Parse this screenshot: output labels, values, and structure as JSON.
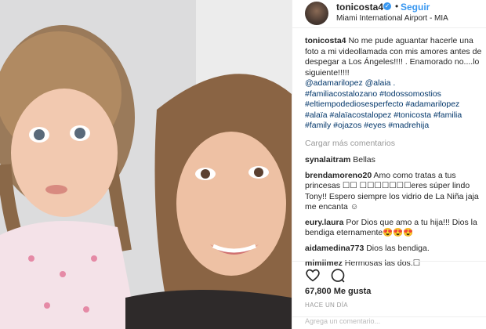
{
  "post": {
    "username": "tonicosta4",
    "separator": "•",
    "follow_label": "Seguir",
    "location": "Miami International Airport - MIA"
  },
  "caption": {
    "username": "tonicosta4",
    "text": "No me pude aguantar hacerle una foto a mi videollamada con mis amores antes de despegar a Los Ángeles!!!! . Enamorado no....lo siguiente!!!!!",
    "mentions": "@adamarilopez @alaia .",
    "hashtags_line1": "#familiacostalozano #todossomostios",
    "hashtags_line2": "#eltiempodediosesperfecto #adamarilopez",
    "hashtags_line3": "#alaïa #alaïacostalopez #tonicosta #familia",
    "hashtags_line4": "#family #ojazos #eyes #madrehija"
  },
  "load_more": "Cargar más comentarios",
  "comments": [
    {
      "username": "synalaitram",
      "text": "Bellas"
    },
    {
      "username": "brendamoreno20",
      "text": "Amo como tratas a tus princesas ☐☐ ☐☐☐☐☐☐☐eres súper lindo Tony!! Espero siempre los vidrio de La Niña jaja me encanta ☺"
    },
    {
      "username": "eury.laura",
      "text": "Por Dios que amo a tu hija!!! Dios la bendiga eternamente😍😍😍"
    },
    {
      "username": "aidamedina773",
      "text": "Dios las bendiga."
    },
    {
      "username": "mimiimez",
      "text": "Hermosas las dos.☐"
    }
  ],
  "actions": {
    "like_icon": "heart-icon",
    "comment_icon": "comment-bubble-icon"
  },
  "likes": "67,800 Me gusta",
  "timestamp": "HACE UN DÍA",
  "add_comment_placeholder": "Agrega un comentario...",
  "colors": {
    "link": "#003569",
    "follow": "#3897f0",
    "muted": "#999999",
    "text": "#262626"
  }
}
